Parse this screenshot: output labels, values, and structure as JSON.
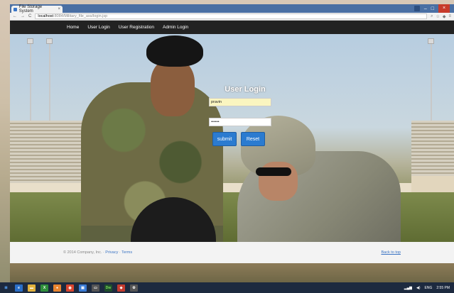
{
  "browser": {
    "tab_title": "File Storage System",
    "tab_close": "×",
    "nav_back": "←",
    "nav_forward": "→",
    "nav_reload": "C",
    "url_host": "localhost",
    "url_path": ":8084/Military_file_ass/login.jsp",
    "window_minimize": "–",
    "window_maximize": "□",
    "window_close": "×"
  },
  "site_nav": {
    "items": [
      {
        "label": "Home"
      },
      {
        "label": "User Login"
      },
      {
        "label": "User Registration"
      },
      {
        "label": "Admin Login"
      }
    ]
  },
  "login": {
    "title": "User Login",
    "username_value": "pravin",
    "password_value": "••••••",
    "submit_label": "submit",
    "reset_label": "Reset"
  },
  "footer": {
    "copyright": "© 2014 Company, Inc. · ",
    "privacy": "Privacy",
    "separator": " · ",
    "terms": "Terms",
    "back_to_top": "Back to top"
  },
  "taskbar": {
    "lang": "ENG",
    "time": "2:55 PM"
  },
  "colors": {
    "navbar": "#222222",
    "primary_button": "#2b7bd0",
    "link": "#3b74c4",
    "tab_strip": "#4a6fa3",
    "taskbar": "#1d2a3f"
  }
}
